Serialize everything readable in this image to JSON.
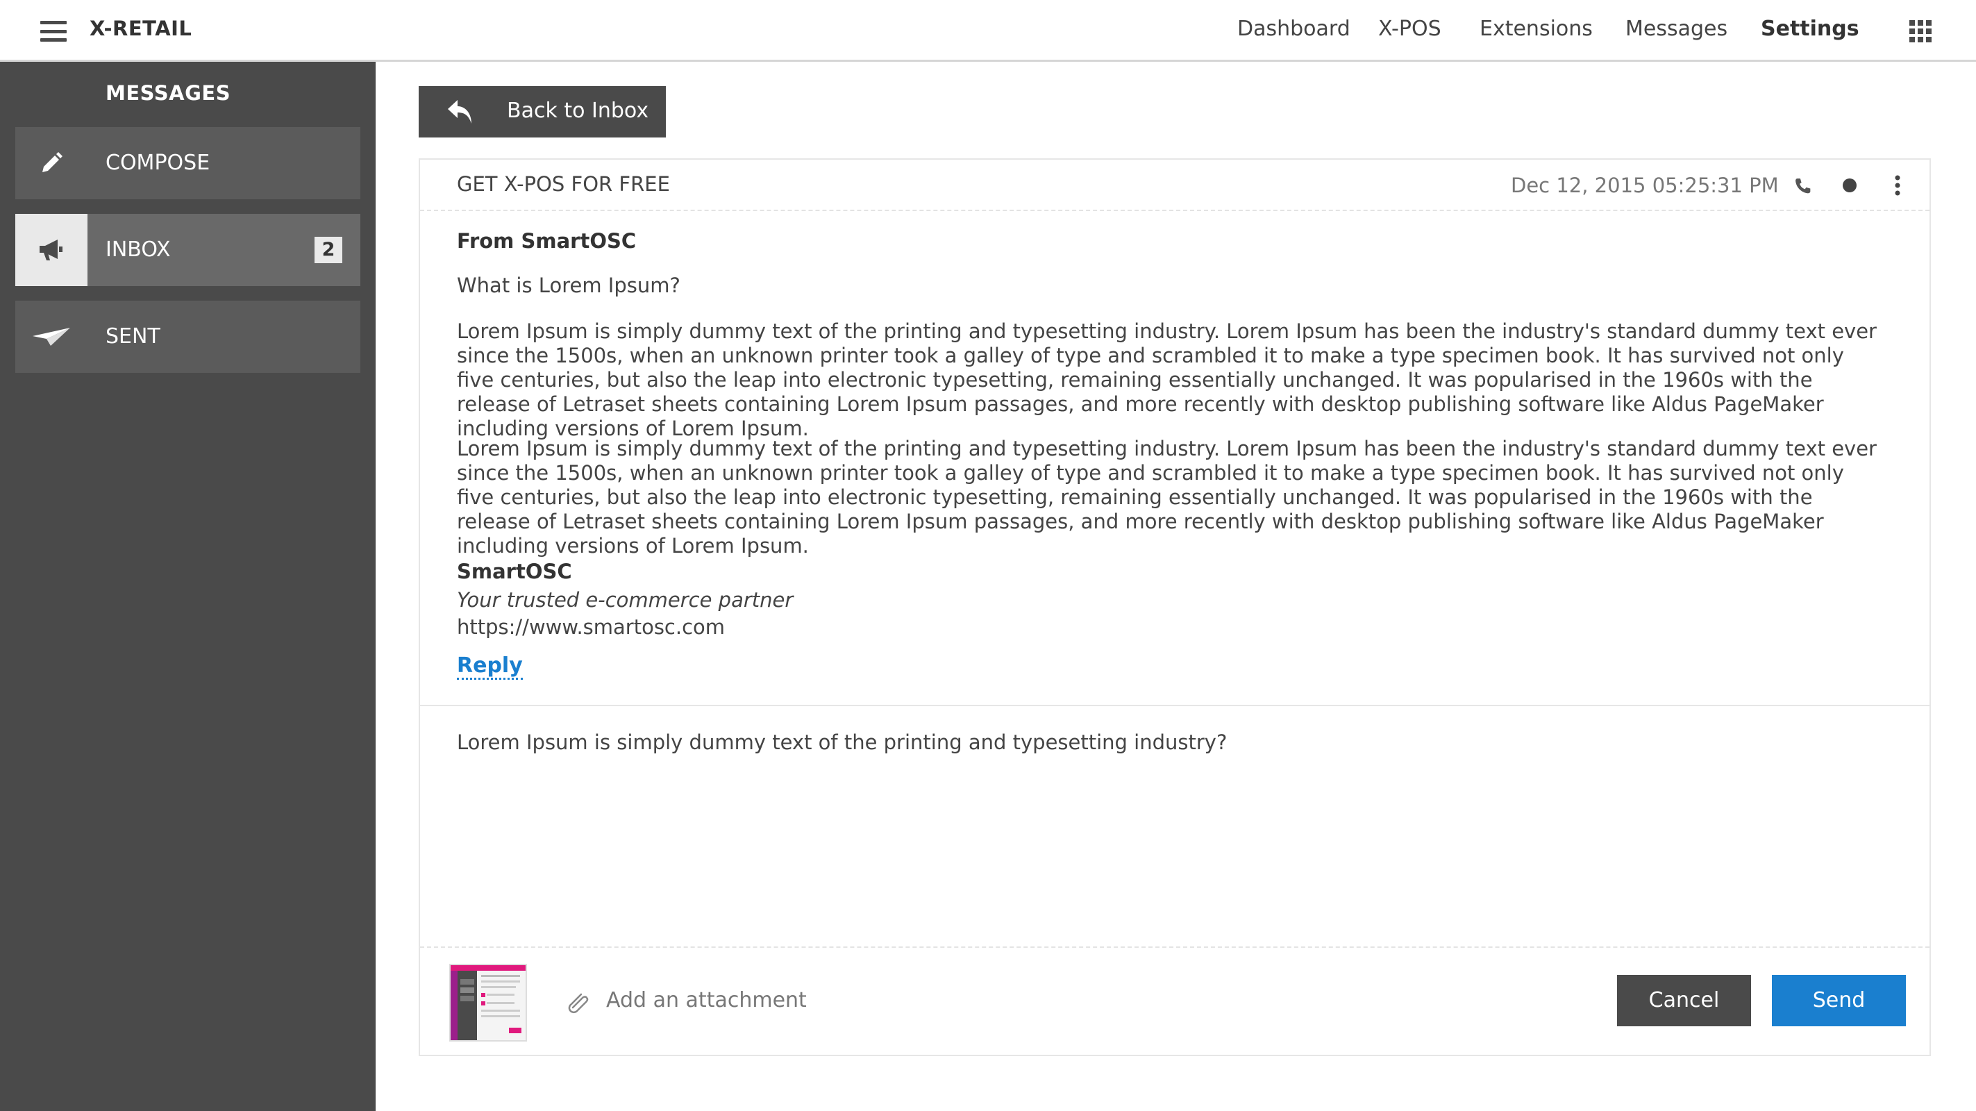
{
  "app": {
    "title": "X-RETAIL"
  },
  "nav": {
    "items": [
      {
        "label": "Dashboard"
      },
      {
        "label": "X-POS"
      },
      {
        "label": "Extensions"
      },
      {
        "label": "Messages"
      },
      {
        "label": "Settings",
        "active": true
      }
    ]
  },
  "sidebar": {
    "title": "MESSAGES",
    "items": [
      {
        "label": "COMPOSE",
        "icon": "pencil-icon"
      },
      {
        "label": "INBOX",
        "icon": "megaphone-icon",
        "badge": "2",
        "active": true
      },
      {
        "label": "SENT",
        "icon": "paper-plane-icon"
      }
    ]
  },
  "back_button": {
    "label": "Back to Inbox",
    "icon": "reply-arrow-icon"
  },
  "message": {
    "subject": "GET X-POS FOR FREE",
    "date": "Dec 12, 2015 05:25:31 PM",
    "from": "From SmartOSC",
    "question": "What is Lorem Ipsum?",
    "paragraphs": [
      "Lorem Ipsum is simply dummy text of the printing and typesetting industry. Lorem Ipsum has been the industry's standard dummy text ever since the 1500s, when an unknown printer took a galley of type and scrambled it to make a type specimen book. It has survived not only five centuries, but also the leap into electronic typesetting, remaining essentially unchanged. It was popularised in the 1960s with the release of Letraset sheets containing Lorem Ipsum passages, and more recently with desktop publishing software like Aldus PageMaker including versions of Lorem Ipsum.",
      "Lorem Ipsum is simply dummy text of the printing and typesetting industry. Lorem Ipsum has been the industry's standard dummy text ever since the 1500s, when an unknown printer took a galley of type and scrambled it to make a type specimen book. It has survived not only five centuries, but also the leap into electronic typesetting, remaining essentially unchanged. It was popularised in the 1960s with the release of Letraset sheets containing Lorem Ipsum passages, and more recently with desktop publishing software like Aldus PageMaker including versions of Lorem Ipsum."
    ],
    "signature": {
      "name": "SmartOSC",
      "tagline": "Your trusted e-commerce partner",
      "url": "https://www.smartosc.com"
    },
    "reply_label": "Reply"
  },
  "reply": {
    "text": "Lorem Ipsum is simply dummy text of the printing and typesetting industry?",
    "attachment_label": "Add an attachment",
    "cancel_label": "Cancel",
    "send_label": "Send"
  },
  "colors": {
    "sidebar_bg": "#4a4a4a",
    "accent_blue": "#1a7fcf",
    "dark_button": "#4a4a4a"
  }
}
